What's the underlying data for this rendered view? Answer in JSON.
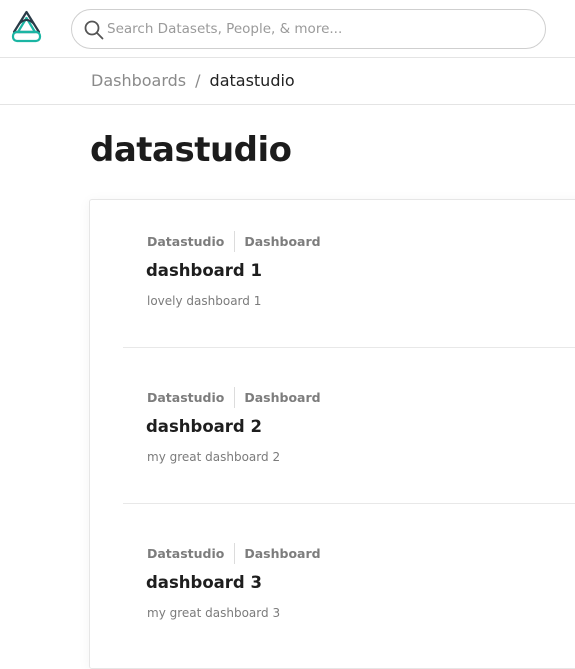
{
  "search": {
    "placeholder": "Search Datasets, People, & more..."
  },
  "breadcrumb": {
    "parent": "Dashboards",
    "separator": "/",
    "current": "datastudio"
  },
  "page": {
    "title": "datastudio"
  },
  "colors": {
    "logo_accent": "#1bb5a3",
    "logo_dark": "#2a3b48"
  },
  "dashboards": [
    {
      "platform": "Datastudio",
      "type": "Dashboard",
      "title": "dashboard 1",
      "description": "lovely dashboard 1"
    },
    {
      "platform": "Datastudio",
      "type": "Dashboard",
      "title": "dashboard 2",
      "description": "my great dashboard 2"
    },
    {
      "platform": "Datastudio",
      "type": "Dashboard",
      "title": "dashboard 3",
      "description": "my great dashboard 3"
    }
  ]
}
